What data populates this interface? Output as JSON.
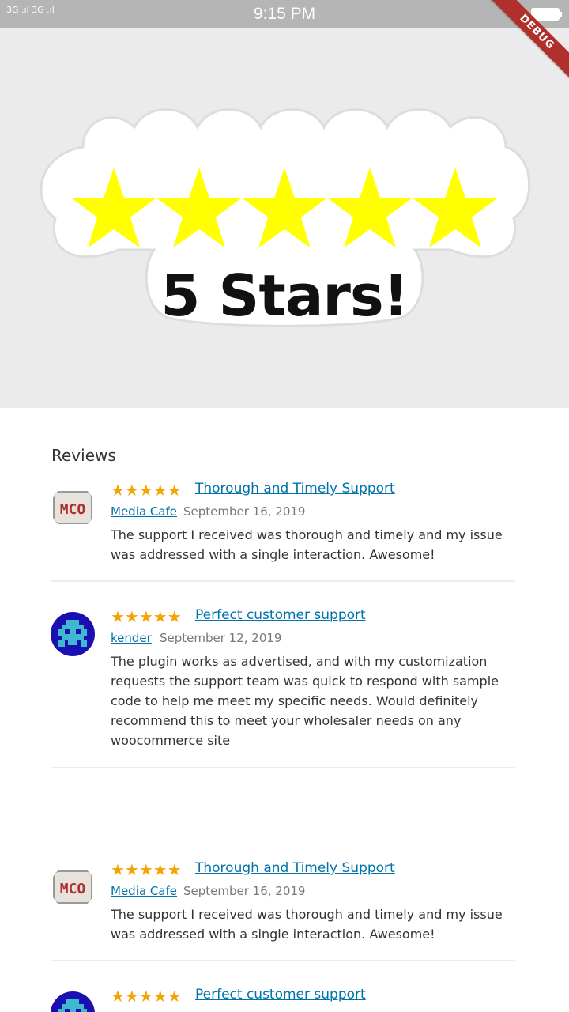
{
  "status_bar": {
    "signal": "3G .ıl  3G .ıl",
    "time": "9:15 PM"
  },
  "debug_ribbon": "DEBUG",
  "hero": {
    "stars_count": 5,
    "text": "5 Stars!",
    "star_color": "#ffff00"
  },
  "reviews": {
    "heading": "Reviews",
    "items": [
      {
        "stars": "★★★★★",
        "title": "Thorough and Timely Support",
        "author": "Media Cafe",
        "date": "September 16, 2019",
        "body": "The support I received was thorough and timely and my issue was addressed with a single interaction. Awesome!",
        "avatar": "mco-logo-avatar"
      },
      {
        "stars": "★★★★★",
        "title": "Perfect customer support",
        "author": "kender",
        "date": "September 12, 2019",
        "body": "The plugin works as advertised, and with my customization requests the support team was quick to respond with sample code to help me meet my specific needs. Would definitely recommend this to meet your wholesaler needs on any woocommerce site",
        "avatar": "pixel-invader-avatar"
      },
      {
        "stars": "★★★★★",
        "title": "Thorough and Timely Support",
        "author": "Media Cafe",
        "date": "September 16, 2019",
        "body": "The support I received was thorough and timely and my issue was addressed with a single interaction. Awesome!",
        "avatar": "mco-logo-avatar"
      },
      {
        "stars": "★★★★★",
        "title": "Perfect customer support",
        "avatar": "pixel-invader-avatar"
      }
    ]
  },
  "colors": {
    "link": "#0073aa",
    "star": "#f4a300",
    "status_bar": "#b5b5b5",
    "hero_bg": "#ebebeb",
    "ribbon": "#b0302c"
  }
}
